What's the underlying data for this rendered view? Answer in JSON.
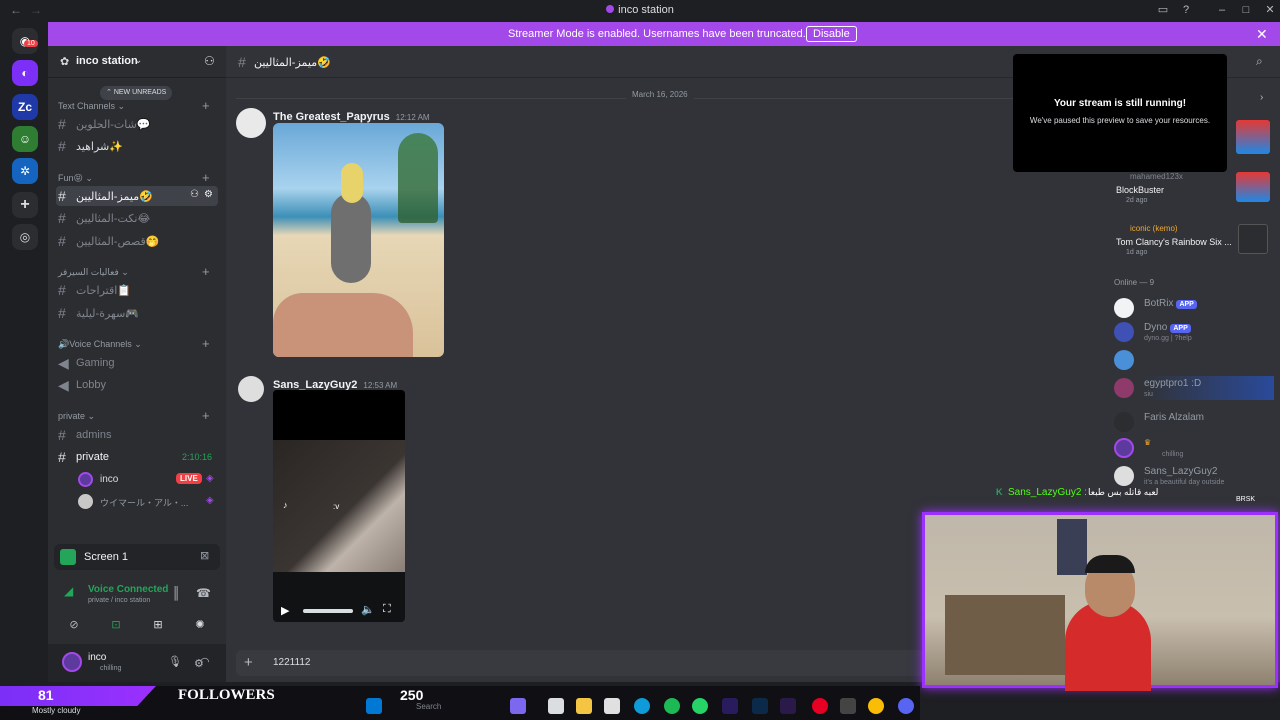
{
  "window": {
    "title": "inco station"
  },
  "banner": {
    "text": "Streamer Mode is enabled. Usernames have been truncated.",
    "button": "Disable",
    "close": "✕"
  },
  "guild_badge": "10",
  "server": {
    "name": "inco station"
  },
  "new_unreads": "NEW UNREADS",
  "categories": {
    "text": "Text Channels",
    "fun": "Fun😝",
    "arabic": "فعاليات السيرفر",
    "voice": "Voice Channels",
    "private": "private"
  },
  "channels": {
    "c1": "شات-الحلوين💬",
    "c2": "شراهيد✨",
    "c3": "ميمز-المثاليين🤣",
    "c4": "نكت-المثاليين😂",
    "c5": "قصص-المثاليين🤭",
    "c6": "اقتراحات📋",
    "c7": "سهرة-ليلية🎮",
    "v1": "Gaming",
    "v2": "Lobby",
    "p1": "admins",
    "p2": "private"
  },
  "voice": {
    "timer": "2:10:16",
    "user1": "inco",
    "live": "LIVE",
    "user2": "ウイマール・アル・..."
  },
  "screen_panel": {
    "title": "Screen 1"
  },
  "voice_panel": {
    "status": "Voice Connected",
    "channel": "private / inco station"
  },
  "user_panel": {
    "name": "inco",
    "status": "chilling"
  },
  "chat": {
    "channel": "ميمز-المثاليين🤣",
    "date": "March 16, 2026",
    "msg1": {
      "author": "The Greatest_Papyrus",
      "time": "12:12 AM"
    },
    "msg2": {
      "author": "Sans_LazyGuy2",
      "time": "12:53 AM",
      "video_overlay": ":v"
    },
    "input_value": "1221112"
  },
  "stream_popup": {
    "title": "Your stream is still running!",
    "body": "We've paused this preview to save your resources."
  },
  "activities": {
    "a1_user": "mahamed123x",
    "a1_game": "BlockBuster",
    "a1_time": "2d ago",
    "a2_user": "iconic (kemo)",
    "a2_game": "Tom Clancy's Rainbow Six ...",
    "a2_time": "1d ago"
  },
  "online_header": "Online — 9",
  "members": {
    "m1": "BotRix",
    "m2": "Dyno",
    "m2_sub": "dyno.gg | ?help",
    "m4": "egyptpro1 :D",
    "m4_sub": "siu",
    "m5": "Faris Alzalam",
    "m6_sub": "chilling",
    "m7": "Sans_LazyGuy2",
    "m7_sub": "it's a beautiful day outside",
    "app": "APP"
  },
  "overlay": {
    "chat_name": "Sans_LazyGuy2 :",
    "chat_text": "لعبه قاتله بس طبعا",
    "brand": "BRSK",
    "followers_count": "81",
    "followers_label": "FOLLOWERS",
    "goal": "250",
    "weather": "Mostly cloudy"
  },
  "taskbar": {
    "search": "Search"
  }
}
